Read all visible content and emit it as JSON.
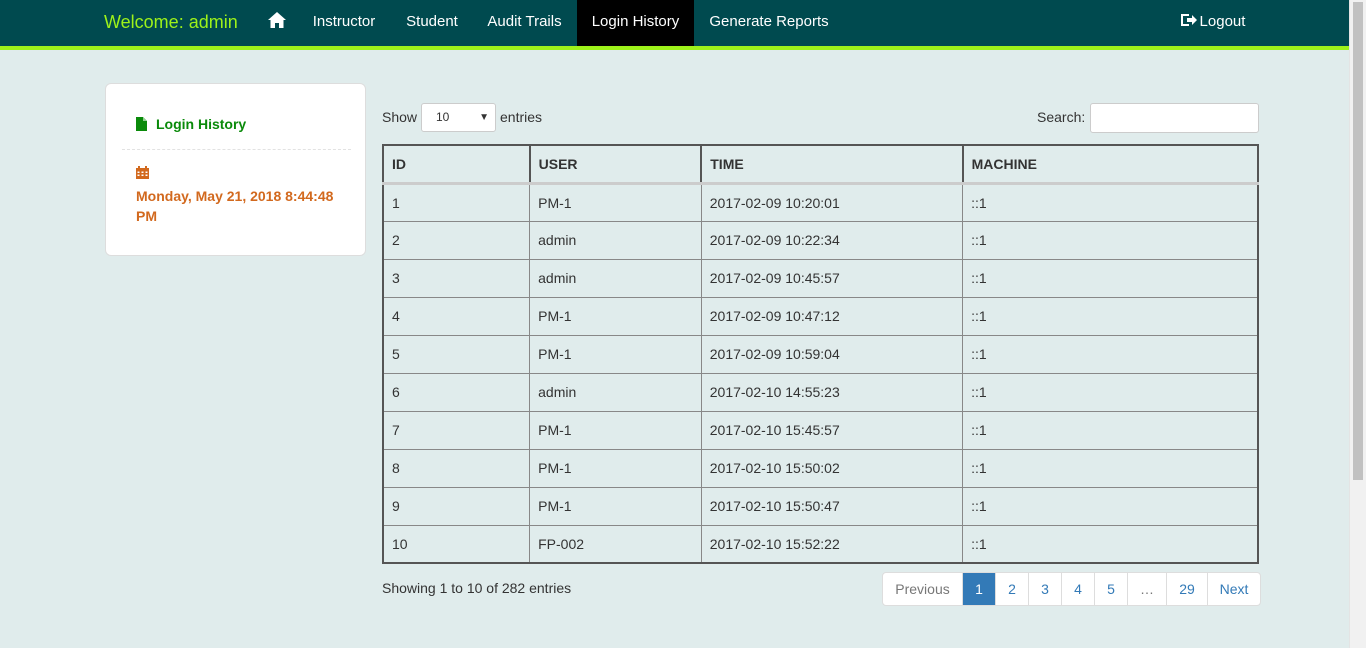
{
  "nav": {
    "brand": "Welcome: admin",
    "home_icon": "home-icon",
    "items": [
      {
        "label": "Instructor"
      },
      {
        "label": "Student"
      },
      {
        "label": "Audit Trails"
      },
      {
        "label": "Login History",
        "active": true
      },
      {
        "label": "Generate Reports"
      }
    ],
    "logout": "Logout",
    "colors": {
      "bar": "#004a4f",
      "accent": "#9df21a",
      "active": "#000000"
    }
  },
  "sidebar": {
    "item_label": "Login History",
    "date_text": "Monday, May 21, 2018 8:44:48 PM"
  },
  "controls": {
    "show_label": "Show",
    "entries_value": "10",
    "entries_label": "entries",
    "search_label": "Search:",
    "search_value": ""
  },
  "table": {
    "columns": [
      "ID",
      "USER",
      "TIME",
      "MACHINE"
    ],
    "rows": [
      [
        "1",
        "PM-1",
        "2017-02-09 10:20:01",
        "::1"
      ],
      [
        "2",
        "admin",
        "2017-02-09 10:22:34",
        "::1"
      ],
      [
        "3",
        "admin",
        "2017-02-09 10:45:57",
        "::1"
      ],
      [
        "4",
        "PM-1",
        "2017-02-09 10:47:12",
        "::1"
      ],
      [
        "5",
        "PM-1",
        "2017-02-09 10:59:04",
        "::1"
      ],
      [
        "6",
        "admin",
        "2017-02-10 14:55:23",
        "::1"
      ],
      [
        "7",
        "PM-1",
        "2017-02-10 15:45:57",
        "::1"
      ],
      [
        "8",
        "PM-1",
        "2017-02-10 15:50:02",
        "::1"
      ],
      [
        "9",
        "PM-1",
        "2017-02-10 15:50:47",
        "::1"
      ],
      [
        "10",
        "FP-002",
        "2017-02-10 15:52:22",
        "::1"
      ]
    ]
  },
  "footer": {
    "showing": "Showing 1 to 10 of 282 entries",
    "pagination": {
      "previous": "Previous",
      "pages": [
        "1",
        "2",
        "3",
        "4",
        "5",
        "…",
        "29"
      ],
      "current": "1",
      "next": "Next"
    }
  }
}
